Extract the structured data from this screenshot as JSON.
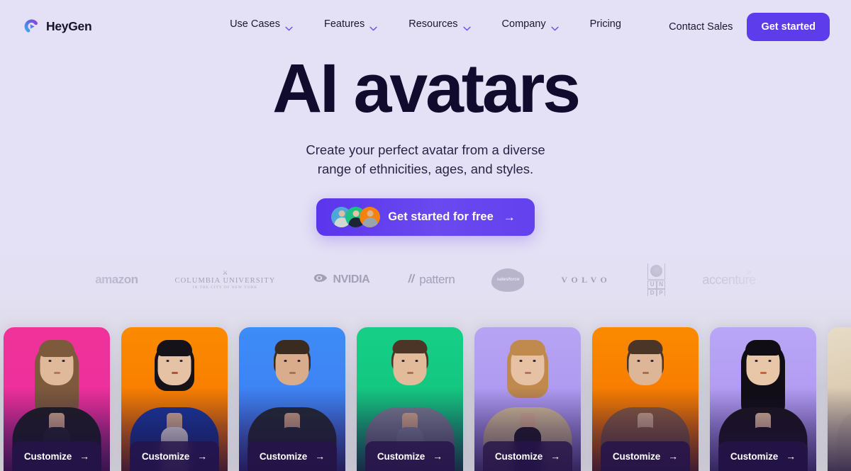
{
  "brand": {
    "name": "HeyGen",
    "logo_icon": "heygen-play-mark",
    "colors": {
      "grad_start": "#3db7e4",
      "grad_end": "#8b33e0"
    }
  },
  "nav": {
    "items": [
      {
        "label": "Use Cases",
        "has_dropdown": true,
        "icon": "chevron-down-icon"
      },
      {
        "label": "Features",
        "has_dropdown": true,
        "icon": "chevron-down-icon"
      },
      {
        "label": "Resources",
        "has_dropdown": true,
        "icon": "chevron-down-icon"
      },
      {
        "label": "Company",
        "has_dropdown": true,
        "icon": "chevron-down-icon"
      },
      {
        "label": "Pricing",
        "has_dropdown": false,
        "icon": ""
      }
    ],
    "contact_sales": "Contact Sales",
    "get_started": "Get started",
    "accent_color": "#5c3ceb"
  },
  "hero": {
    "title": "AI avatars",
    "subtitle_line1": "Create your perfect avatar from a diverse",
    "subtitle_line2": "range of ethnicities, ages, and styles.",
    "cta_label": "Get started for free",
    "cta_arrow": "→",
    "cta_avatars": [
      {
        "name": "cta-avatar-1",
        "bg": "#4fa8d8",
        "skin": "#d9bfa6",
        "outfit": "#cfd8d2"
      },
      {
        "name": "cta-avatar-2",
        "bg": "#1fbf86",
        "skin": "#e4c4a4",
        "outfit": "#1d2436"
      },
      {
        "name": "cta-avatar-3",
        "bg": "#f4820d",
        "skin": "#dcb392",
        "outfit": "#9aa4ac"
      }
    ],
    "title_color": "#110b2e",
    "bg_color": "#e4e0f5"
  },
  "logos": {
    "items": [
      {
        "name": "amazon-logo",
        "text": "amazon"
      },
      {
        "name": "columbia-university-logo",
        "text": "COLUMBIA UNIVERSITY",
        "subtext": "IN THE CITY OF NEW YORK"
      },
      {
        "name": "nvidia-logo",
        "text": "NVIDIA"
      },
      {
        "name": "pattern-logo",
        "text": "pattern"
      },
      {
        "name": "salesforce-logo",
        "text": "salesforce"
      },
      {
        "name": "volvo-logo",
        "text": "VOLVO"
      },
      {
        "name": "undp-logo",
        "text": "UNDP",
        "letters": [
          "U",
          "N",
          "D",
          "P"
        ]
      },
      {
        "name": "accenture-logo",
        "text": "accenture"
      }
    ]
  },
  "avatar_rail": {
    "customize_label": "Customize",
    "customize_arrow": "→",
    "cards": [
      {
        "name": "avatar-card-1",
        "bg_top": "#f0329a",
        "bg_bottom": "#c5259b",
        "skin": "#e0b89a",
        "hair": "#7d5a3c",
        "hair_w": 62,
        "hair_h": 104,
        "outfit": "#1d1d22",
        "shirt": "#24242b"
      },
      {
        "name": "avatar-card-2",
        "bg_top": "#fb8a00",
        "bg_bottom": "#f06a00",
        "skin": "#e6c2a4",
        "hair": "#15121a",
        "hair_w": 56,
        "hair_h": 70,
        "outfit": "#18389e",
        "shirt": "#f1f0ee"
      },
      {
        "name": "avatar-card-3",
        "bg_top": "#3d8cf7",
        "bg_bottom": "#4b6de8",
        "skin": "#d9ad8c",
        "hair": "#3a2b21",
        "hair_w": 52,
        "hair_h": 50,
        "outfit": "#222b33",
        "shirt": "#222b33"
      },
      {
        "name": "avatar-card-4",
        "bg_top": "#16cf86",
        "bg_bottom": "#10b977",
        "skin": "#e2bb9b",
        "hair": "#4b3526",
        "hair_w": 52,
        "hair_h": 46,
        "outfit": "#7b7f93",
        "shirt": "#858a9e"
      },
      {
        "name": "avatar-card-5",
        "bg_top": "#b6a4f3",
        "bg_bottom": "#a48cec",
        "skin": "#e6c1a3",
        "hair": "#c08a4e",
        "hair_w": 58,
        "hair_h": 80,
        "outfit": "#d6c09a",
        "shirt": "#201c24"
      },
      {
        "name": "avatar-card-6",
        "bg_top": "#fb8a00",
        "bg_bottom": "#ef6b00",
        "skin": "#dcb696",
        "hair": "#4a3526",
        "hair_w": 52,
        "hair_h": 52,
        "outfit": "#8a5c3e",
        "shirt": "#8a5c3e"
      },
      {
        "name": "avatar-card-7",
        "bg_top": "#b9a6f6",
        "bg_bottom": "#a68eee",
        "skin": "#e8c7a8",
        "hair": "#100d14",
        "hair_w": 62,
        "hair_h": 108,
        "outfit": "#191419",
        "shirt": "#191419"
      },
      {
        "name": "avatar-card-8-peek",
        "bg_top": "#e8dcc8",
        "bg_bottom": "#cbbfa8",
        "skin": "#e0bb99",
        "hair": "#3b2a1f",
        "hair_w": 50,
        "hair_h": 56,
        "outfit": "#cdbfa6",
        "shirt": "#cdbfa6"
      }
    ]
  }
}
